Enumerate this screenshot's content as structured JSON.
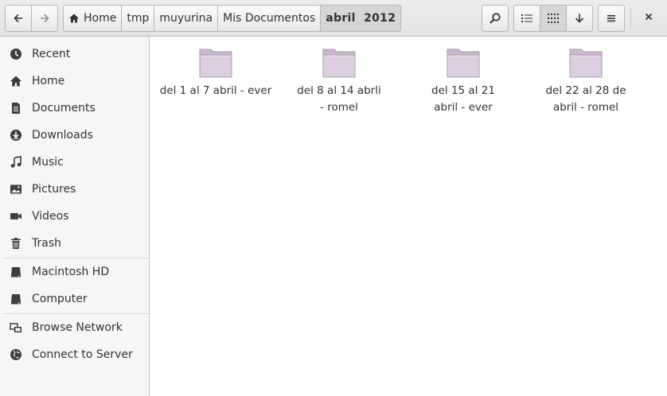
{
  "header": {
    "breadcrumbs": [
      "Home",
      "tmp",
      "muyurina",
      "Mis Documentos",
      "abril  2012"
    ]
  },
  "sidebar": {
    "places": [
      {
        "label": "Recent",
        "icon": "clock-icon"
      },
      {
        "label": "Home",
        "icon": "home-icon"
      },
      {
        "label": "Documents",
        "icon": "document-icon"
      },
      {
        "label": "Downloads",
        "icon": "download-icon"
      },
      {
        "label": "Music",
        "icon": "music-icon"
      },
      {
        "label": "Pictures",
        "icon": "picture-icon"
      },
      {
        "label": "Videos",
        "icon": "video-icon"
      },
      {
        "label": "Trash",
        "icon": "trash-icon"
      }
    ],
    "devices": [
      {
        "label": "Macintosh HD",
        "icon": "drive-icon"
      },
      {
        "label": "Computer",
        "icon": "drive-icon"
      }
    ],
    "network": [
      {
        "label": "Browse Network",
        "icon": "network-icon"
      },
      {
        "label": "Connect to Server",
        "icon": "globe-icon"
      }
    ]
  },
  "files": [
    {
      "name": "del 1 al 7 abril - ever"
    },
    {
      "name": "del 8 al 14 abrli - romel"
    },
    {
      "name": "del 15 al 21 abril - ever"
    },
    {
      "name": "del 22 al 28 de abril - romel"
    }
  ],
  "colors": {
    "folder": "#d9cadc",
    "headerbar": "#e8e8e7",
    "sidebar": "#f6f6f5"
  }
}
